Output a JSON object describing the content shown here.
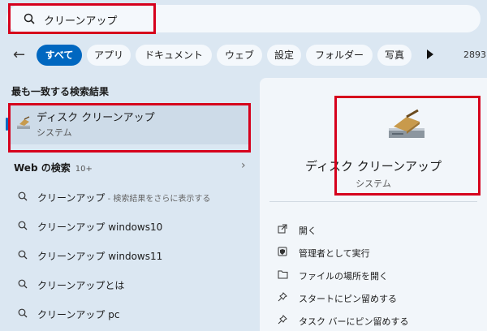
{
  "search": {
    "query": "クリーンアップ"
  },
  "filters": {
    "tabs": [
      "すべて",
      "アプリ",
      "ドキュメント",
      "ウェブ",
      "設定",
      "フォルダー",
      "写真"
    ],
    "active_index": 0,
    "count": "2893"
  },
  "best_match": {
    "header": "最も一致する検索結果",
    "title": "ディスク クリーンアップ",
    "subtitle": "システム",
    "icon": "disk-cleanup-icon"
  },
  "web": {
    "header": "Web の検索",
    "count": "10+",
    "suggestions": [
      {
        "main": "クリーンアップ",
        "sub": " - 検索結果をさらに表示する"
      },
      {
        "main": "クリーンアップ windows10",
        "sub": ""
      },
      {
        "main": "クリーンアップ windows11",
        "sub": ""
      },
      {
        "main": "クリーンアップとは",
        "sub": ""
      },
      {
        "main": "クリーンアップ pc",
        "sub": ""
      }
    ]
  },
  "detail": {
    "title": "ディスク クリーンアップ",
    "type": "システム",
    "actions": [
      {
        "label": "開く",
        "icon": "open-icon"
      },
      {
        "label": "管理者として実行",
        "icon": "shield-icon"
      },
      {
        "label": "ファイルの場所を開く",
        "icon": "folder-icon"
      },
      {
        "label": "スタートにピン留めする",
        "icon": "pin-icon"
      },
      {
        "label": "タスク バーにピン留めする",
        "icon": "pin-icon"
      }
    ]
  },
  "colors": {
    "accent": "#0067c0",
    "highlight": "#d6001c",
    "background": "#dbe7f2"
  }
}
